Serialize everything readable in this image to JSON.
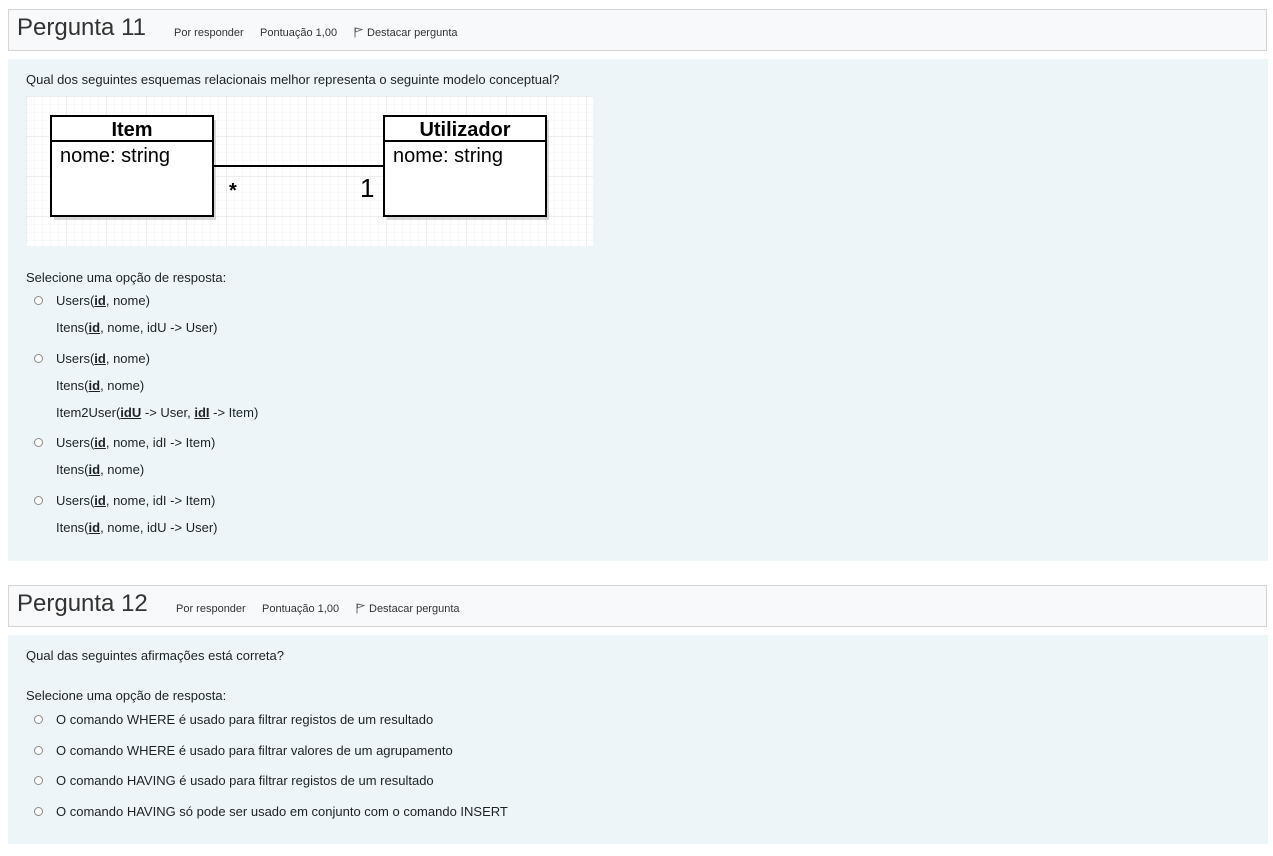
{
  "q11": {
    "title": "Pergunta 11",
    "status": "Por responder",
    "score": "Pontuação 1,00",
    "flag_label": "Destacar pergunta",
    "question": "Qual dos seguintes esquemas relacionais melhor representa o seguinte modelo conceptual?",
    "diagram": {
      "left_entity": "Item",
      "left_attr": "nome: string",
      "right_entity": "Utilizador",
      "right_attr": "nome: string",
      "left_mult": "*",
      "right_mult": "1"
    },
    "prompt": "Selecione uma opção de resposta:",
    "options": [
      [
        [
          {
            "t": "Users("
          },
          {
            "u": "id"
          },
          {
            "t": ", nome)"
          }
        ],
        [
          {
            "t": "Itens("
          },
          {
            "u": "id"
          },
          {
            "t": ", nome, idU -> User)"
          }
        ]
      ],
      [
        [
          {
            "t": "Users("
          },
          {
            "u": "id"
          },
          {
            "t": ", nome)"
          }
        ],
        [
          {
            "t": "Itens("
          },
          {
            "u": "id"
          },
          {
            "t": ", nome)"
          }
        ],
        [
          {
            "t": "Item2User("
          },
          {
            "u": "idU"
          },
          {
            "t": " -> User, "
          },
          {
            "u": "idI"
          },
          {
            "t": " -> Item)"
          }
        ]
      ],
      [
        [
          {
            "t": "Users("
          },
          {
            "u": "id"
          },
          {
            "t": ", nome, idI -> Item)"
          }
        ],
        [
          {
            "t": "Itens("
          },
          {
            "u": "id"
          },
          {
            "t": ", nome)"
          }
        ]
      ],
      [
        [
          {
            "t": "Users("
          },
          {
            "u": "id"
          },
          {
            "t": ", nome, idI -> Item)"
          }
        ],
        [
          {
            "t": "Itens("
          },
          {
            "u": "id"
          },
          {
            "t": ", nome, idU -> User)"
          }
        ]
      ]
    ]
  },
  "q12": {
    "title": "Pergunta 12",
    "status": "Por responder",
    "score": "Pontuação 1,00",
    "flag_label": "Destacar pergunta",
    "question": "Qual das seguintes afirmações está correta?",
    "prompt": "Selecione uma opção de resposta:",
    "options": [
      "O comando WHERE é usado para filtrar registos de um resultado",
      "O comando WHERE é usado para filtrar valores de um agrupamento",
      "O comando HAVING é usado para filtrar registos de um resultado",
      "O comando HAVING só pode ser usado em conjunto com o comando INSERT"
    ]
  }
}
